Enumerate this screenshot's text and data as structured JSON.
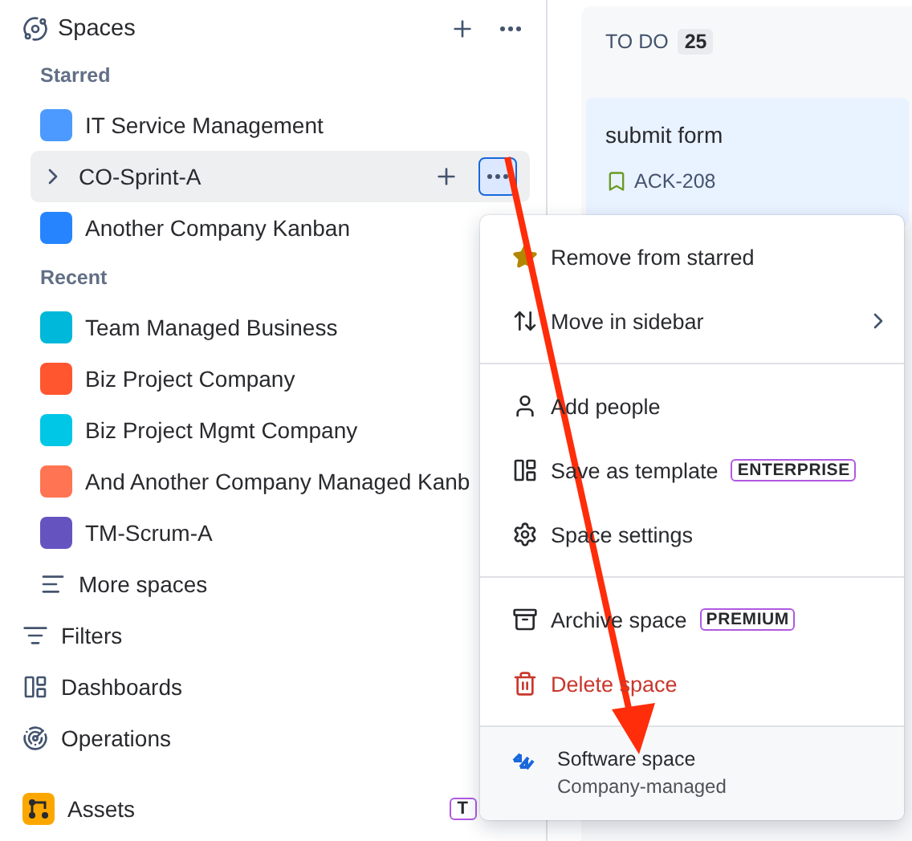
{
  "sidebar": {
    "title": "Spaces",
    "sections": [
      {
        "label": "Starred",
        "items": [
          {
            "kind": "project",
            "name": "IT Service Management",
            "color": "#4c9aff",
            "selected": false
          },
          {
            "kind": "project",
            "name": "CO-Sprint-A",
            "selected": true
          },
          {
            "kind": "project",
            "name": "Another Company Kanban",
            "color": "#2684ff",
            "selected": false
          }
        ]
      },
      {
        "label": "Recent",
        "items": [
          {
            "kind": "project",
            "name": "Team Managed Business",
            "color": "#00b8d9",
            "selected": false
          },
          {
            "kind": "project",
            "name": "Biz Project Company",
            "color": "#ff5630",
            "selected": false
          },
          {
            "kind": "project",
            "name": "Biz Project Mgmt Company",
            "color": "#00c7e6",
            "selected": false
          },
          {
            "kind": "project",
            "name": "And Another Company Managed Kanb",
            "color": "#ff7452",
            "selected": false
          },
          {
            "kind": "project",
            "name": "TM-Scrum-A",
            "color": "#6554c0",
            "selected": false
          },
          {
            "kind": "more",
            "name": "More spaces",
            "selected": false
          }
        ]
      }
    ],
    "nav": [
      {
        "kind": "filters",
        "label": "Filters"
      },
      {
        "kind": "dashboards",
        "label": "Dashboards"
      },
      {
        "kind": "operations",
        "label": "Operations"
      },
      {
        "kind": "assets",
        "label": "Assets",
        "badge": "T"
      }
    ]
  },
  "board": {
    "column": {
      "title": "TO DO",
      "count": "25"
    },
    "card": {
      "summary": "submit form",
      "key": "ACK-208"
    }
  },
  "menu": {
    "groups": [
      [
        {
          "kind": "star",
          "label": "Remove from starred",
          "submenu": false,
          "danger": false
        },
        {
          "kind": "move",
          "label": "Move in sidebar",
          "submenu": true,
          "danger": false
        }
      ],
      [
        {
          "kind": "person",
          "label": "Add people",
          "submenu": false,
          "danger": false
        },
        {
          "kind": "template",
          "label": "Save as template",
          "badge": "ENTERPRISE",
          "submenu": false,
          "danger": false
        },
        {
          "kind": "settings",
          "label": "Space settings",
          "submenu": false,
          "danger": false
        }
      ],
      [
        {
          "kind": "archive",
          "label": "Archive space",
          "badge": "PREMIUM",
          "submenu": false,
          "danger": false
        },
        {
          "kind": "trash",
          "label": "Delete space",
          "submenu": false,
          "danger": true
        }
      ]
    ],
    "footer": {
      "title": "Software space",
      "subtitle": "Company-managed"
    }
  }
}
